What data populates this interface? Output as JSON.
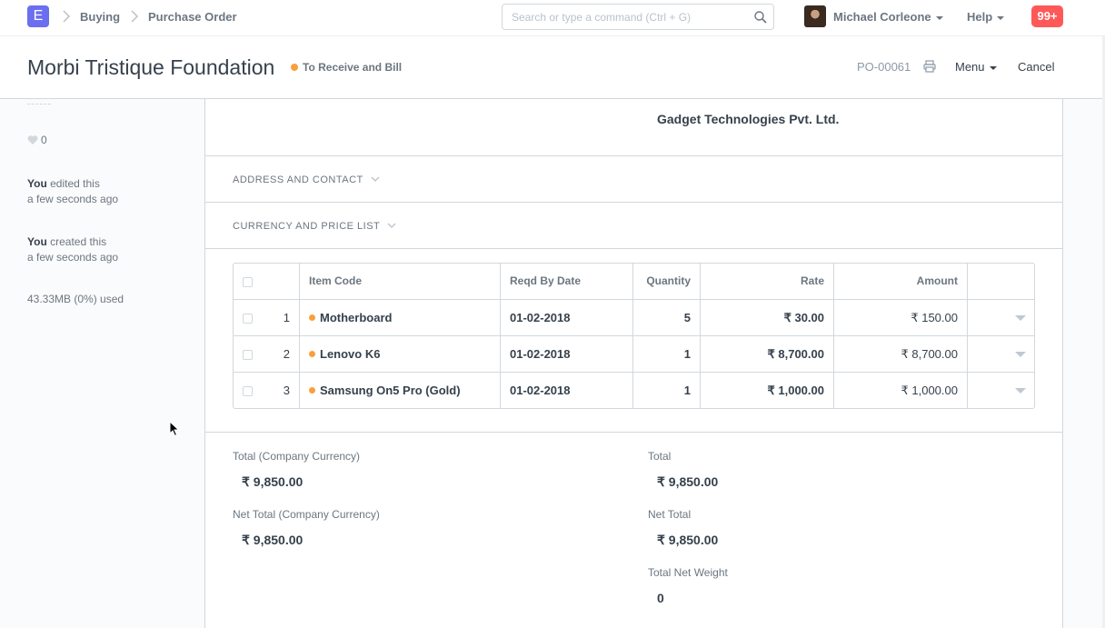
{
  "navbar": {
    "logo_letter": "E",
    "breadcrumbs": [
      "Buying",
      "Purchase Order"
    ],
    "search_placeholder": "Search or type a command (Ctrl + G)",
    "user_name": "Michael Corleone",
    "help_label": "Help",
    "notification_count": "99+"
  },
  "page_head": {
    "title": "Morbi Tristique Foundation",
    "status": "To Receive and Bill",
    "status_color": "#f8a03c",
    "doc_id": "PO-00061",
    "menu_label": "Menu",
    "cancel_label": "Cancel"
  },
  "sidebar": {
    "likes_count": "0",
    "timeline": [
      {
        "actor": "You",
        "action": " edited this",
        "time": "a few seconds ago"
      },
      {
        "actor": "You",
        "action": " created this",
        "time": "a few seconds ago"
      }
    ],
    "usage": "43.33MB (0%) used"
  },
  "form": {
    "supplier_name": "Gadget Technologies Pvt. Ltd.",
    "sections": [
      "ADDRESS AND CONTACT",
      "CURRENCY AND PRICE LIST"
    ],
    "items_table": {
      "columns": [
        "Item Code",
        "Reqd By Date",
        "Quantity",
        "Rate",
        "Amount"
      ],
      "rows": [
        {
          "idx": "1",
          "item_code": "Motherboard",
          "reqd_by_date": "01-02-2018",
          "qty": "5",
          "rate": "₹ 30.00",
          "amount": "₹ 150.00"
        },
        {
          "idx": "2",
          "item_code": "Lenovo K6",
          "reqd_by_date": "01-02-2018",
          "qty": "1",
          "rate": "₹ 8,700.00",
          "amount": "₹ 8,700.00"
        },
        {
          "idx": "3",
          "item_code": "Samsung On5 Pro (Gold)",
          "reqd_by_date": "01-02-2018",
          "qty": "1",
          "rate": "₹ 1,000.00",
          "amount": "₹ 1,000.00"
        }
      ]
    },
    "totals": {
      "total_company_label": "Total (Company Currency)",
      "total_company_value": "₹ 9,850.00",
      "net_total_company_label": "Net Total (Company Currency)",
      "net_total_company_value": "₹ 9,850.00",
      "total_label": "Total",
      "total_value": "₹ 9,850.00",
      "net_total_label": "Net Total",
      "net_total_value": "₹ 9,850.00",
      "total_net_weight_label": "Total Net Weight",
      "total_net_weight_value": "0"
    }
  }
}
